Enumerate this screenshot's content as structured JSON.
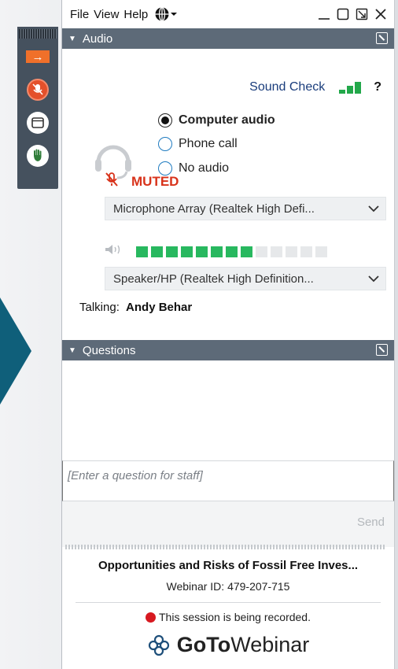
{
  "menubar": {
    "items": [
      "File",
      "View",
      "Help"
    ]
  },
  "icons": {
    "globe": "globe-icon",
    "minimize": "minimize-icon",
    "restore": "restore-icon",
    "popout": "popout-icon",
    "close": "close-icon"
  },
  "rail": {
    "buttons": [
      "collapse-arrow-icon",
      "mic-muted-icon",
      "screen-icon",
      "raise-hand-icon"
    ]
  },
  "audio": {
    "header": "Audio",
    "sound_check": "Sound Check",
    "help": "?",
    "options": [
      {
        "label": "Computer audio",
        "selected": true
      },
      {
        "label": "Phone call",
        "selected": false
      },
      {
        "label": "No audio",
        "selected": false
      }
    ],
    "muted_label": "MUTED",
    "microphone": "Microphone Array (Realtek High Defi...",
    "speaker_level_segments_on": 8,
    "speaker_level_segments_total": 13,
    "speaker": "Speaker/HP (Realtek High Definition...",
    "talking_label": "Talking:",
    "talking_name": "Andy Behar"
  },
  "questions": {
    "header": "Questions",
    "input_placeholder": "[Enter a question for staff]",
    "send_label": "Send"
  },
  "footer": {
    "webinar_title": "Opportunities and Risks of Fossil Free Inves...",
    "webinar_id": "Webinar ID: 479-207-715",
    "recording_notice": "This session is being recorded.",
    "brand_goto": "GoTo",
    "brand_webinar": "Webinar"
  },
  "colors": {
    "header_bg": "#5d6a78",
    "muted": "#d8331b",
    "level_on": "#28b85f",
    "radio_blue": "#1f7bc0",
    "rail_bg": "#45515e",
    "rail_accent": "#f0702a",
    "recording_dot": "#d71920",
    "sound_check_text": "#1a3d7c"
  }
}
